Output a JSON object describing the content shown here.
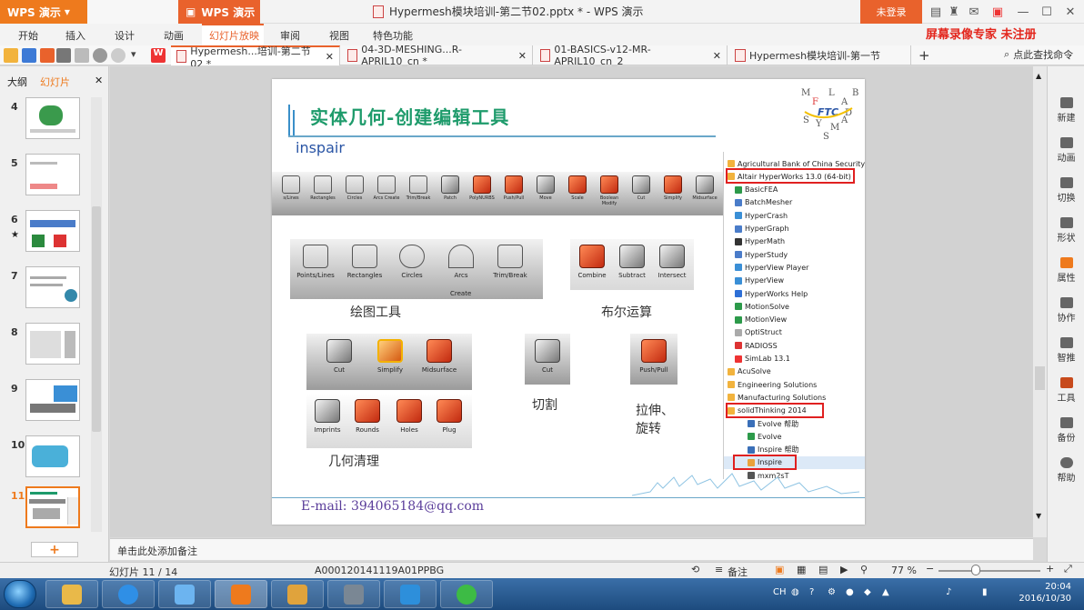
{
  "window": {
    "app_button": "WPS 演示",
    "doc_title": "Hypermesh模块培训-第二节02.pptx * - WPS 演示",
    "login": "未登录",
    "watermark": "屏幕录像专家  未注册"
  },
  "menu": [
    "开始",
    "插入",
    "设计",
    "动画",
    "幻灯片放映",
    "审阅",
    "视图",
    "特色功能"
  ],
  "doc_tabs": [
    "Hypermesh...培训-第二节02 *",
    "04-3D-MESHING...R-APRIL10_cn *",
    "01-BASICS-v12-MR-APRIL10_cn_2",
    "Hypermesh模块培训-第一节"
  ],
  "search_label": "点此查找命令",
  "left_panel": {
    "tab_outline": "大纲",
    "tab_slides": "幻灯片",
    "slide_numbers": [
      "4",
      "5",
      "6",
      "7",
      "8",
      "9",
      "10",
      "11"
    ],
    "add_label": "+"
  },
  "slide": {
    "title": "实体几何-创建编辑工具",
    "subtitle": "inspair",
    "logo_letters": [
      "M",
      "F",
      "L",
      "A",
      "B",
      "FTC",
      "D",
      "S",
      "Y",
      "M",
      "A",
      "S"
    ],
    "strip_tools": [
      "s/Lines",
      "Rectangles",
      "Circles",
      "Arcs Create",
      "Trim/Break",
      "Patch",
      "PolyNURBS",
      "Push/Pull",
      "Move",
      "Scale",
      "Boolean Modify",
      "Cut",
      "Simplify",
      "Midsurface"
    ],
    "draw_tools": [
      "Points/Lines",
      "Rectangles",
      "Circles",
      "Arcs",
      "Trim/Break"
    ],
    "draw_create": "Create",
    "draw_label": "绘图工具",
    "bool_tools": [
      "Combine",
      "Subtract",
      "Intersect"
    ],
    "bool_label": "布尔运算",
    "clean_tools_top": [
      "Cut",
      "Simplify",
      "Midsurface"
    ],
    "clean_tools_bottom": [
      "Imprints",
      "Rounds",
      "Holes",
      "Plug"
    ],
    "clean_label": "几何清理",
    "cut_tool": "Cut",
    "cut_label": "切割",
    "push_tool": "Push/Pull",
    "push_label_1": "拉伸、",
    "push_label_2": "旋转",
    "email": "E-mail: 394065184@qq.com",
    "start_menu": [
      "Agricultural Bank of China Security",
      "Altair HyperWorks 13.0 (64-bit)",
      "BasicFEA",
      "BatchMesher",
      "HyperCrash",
      "HyperGraph",
      "HyperMath",
      "HyperStudy",
      "HyperView Player",
      "HyperView",
      "HyperWorks Help",
      "MotionSolve",
      "MotionView",
      "OptiStruct",
      "RADIOSS",
      "SimLab 13.1",
      "AcuSolve",
      "Engineering Solutions",
      "Manufacturing Solutions",
      "solidThinking 2014",
      "Evolve 帮助",
      "Evolve",
      "Inspire 帮助",
      "Inspire",
      "mxm2sT"
    ]
  },
  "right_panel": [
    "新建",
    "动画",
    "切换",
    "形状",
    "属性",
    "协作",
    "智推",
    "工具",
    "备份",
    "帮助"
  ],
  "notes_placeholder": "单击此处添加备注",
  "status": {
    "slide_count": "幻灯片 11 / 14",
    "template": "A000120141119A01PPBG",
    "notes_btn": "备注",
    "zoom": "77 %"
  },
  "taskbar": {
    "lang": "CH",
    "time": "20:04",
    "date": "2016/10/30"
  },
  "colors": {
    "wps_orange": "#ee7a1d",
    "title_green": "#1e9b6b",
    "highlight_red": "#e02020",
    "email_purple": "#5a3d9a"
  }
}
